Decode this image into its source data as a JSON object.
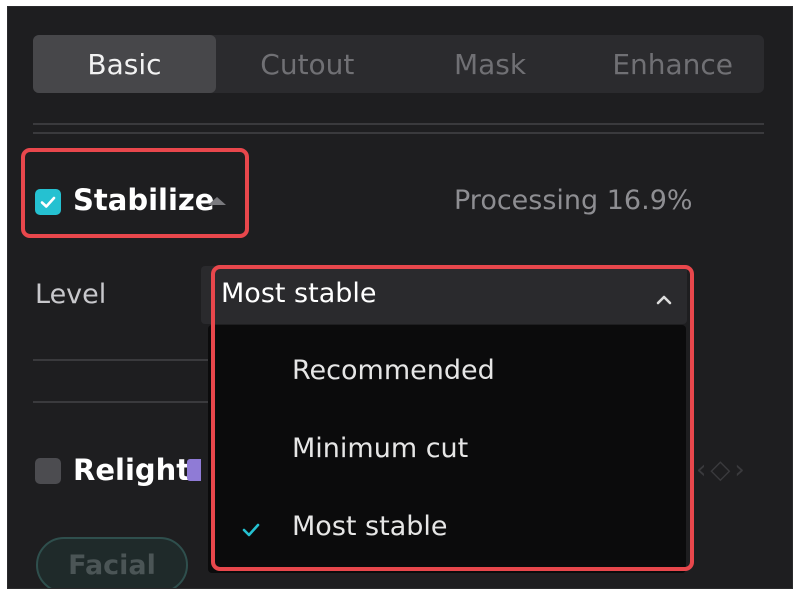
{
  "tabs": [
    {
      "label": "Basic",
      "active": true
    },
    {
      "label": "Cutout",
      "active": false
    },
    {
      "label": "Mask",
      "active": false
    },
    {
      "label": "Enhance",
      "active": false
    }
  ],
  "stabilize": {
    "label": "Stabilize",
    "checked": true,
    "status": "Processing 16.9%"
  },
  "level": {
    "label": "Level",
    "selected": "Most stable",
    "options": [
      {
        "label": "Recommended",
        "selected": false
      },
      {
        "label": "Minimum cut",
        "selected": false
      },
      {
        "label": "Most stable",
        "selected": true
      }
    ]
  },
  "relight": {
    "label": "Relight",
    "checked": false
  },
  "chips": [
    {
      "label": "Facial"
    }
  ],
  "colors": {
    "accent": "#25c1d1",
    "highlight": "#e8474c",
    "panel": "#1e1e20"
  }
}
